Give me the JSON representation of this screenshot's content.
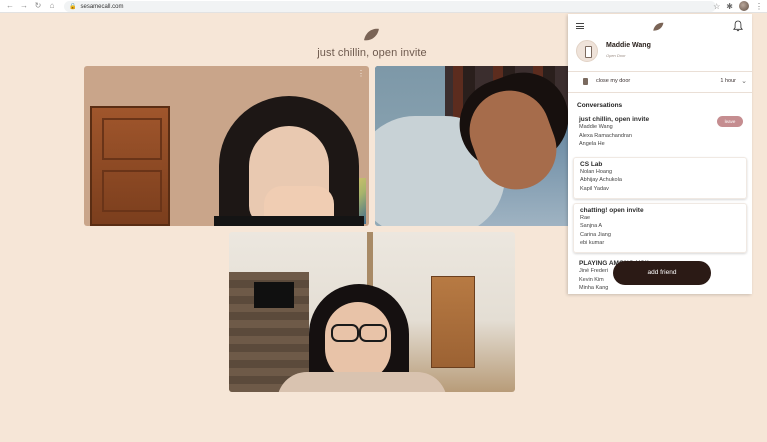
{
  "browser": {
    "url": "sesamecall.com",
    "nav_icons": [
      "back-icon",
      "forward-icon",
      "reload-icon",
      "home-icon"
    ]
  },
  "room": {
    "title": "just chillin, open invite"
  },
  "panel": {
    "profile": {
      "name": "Maddie Wang",
      "status": "Open Door"
    },
    "door": {
      "label": "close my door",
      "duration": "1 hour"
    },
    "conversations_heading": "Conversations",
    "conversations": [
      {
        "title": "just chillin, open invite",
        "members": [
          "Maddie Wang",
          "Alexa Ramachandran",
          "Angela He"
        ],
        "action": "leave"
      },
      {
        "title": "CS Lab",
        "members": [
          "Nolan Hoang",
          "Abhijay Achukola",
          "Kapil Yadav"
        ]
      },
      {
        "title": "chatting! open invite",
        "members": [
          "Rae",
          "Sanjna A",
          "Carina Jiang",
          "ebi kumar"
        ]
      },
      {
        "title": "PLAYING AMONG US!!",
        "members": [
          "Jiné Frederi",
          "Kevin Kim",
          "Minha Kang"
        ]
      }
    ],
    "add_friend_label": "add friend"
  },
  "colors": {
    "page_bg": "#f6e6d7",
    "brand_brown": "#7a6456",
    "leave_button": "#c58d90",
    "add_friend_button": "#2b1a15"
  }
}
